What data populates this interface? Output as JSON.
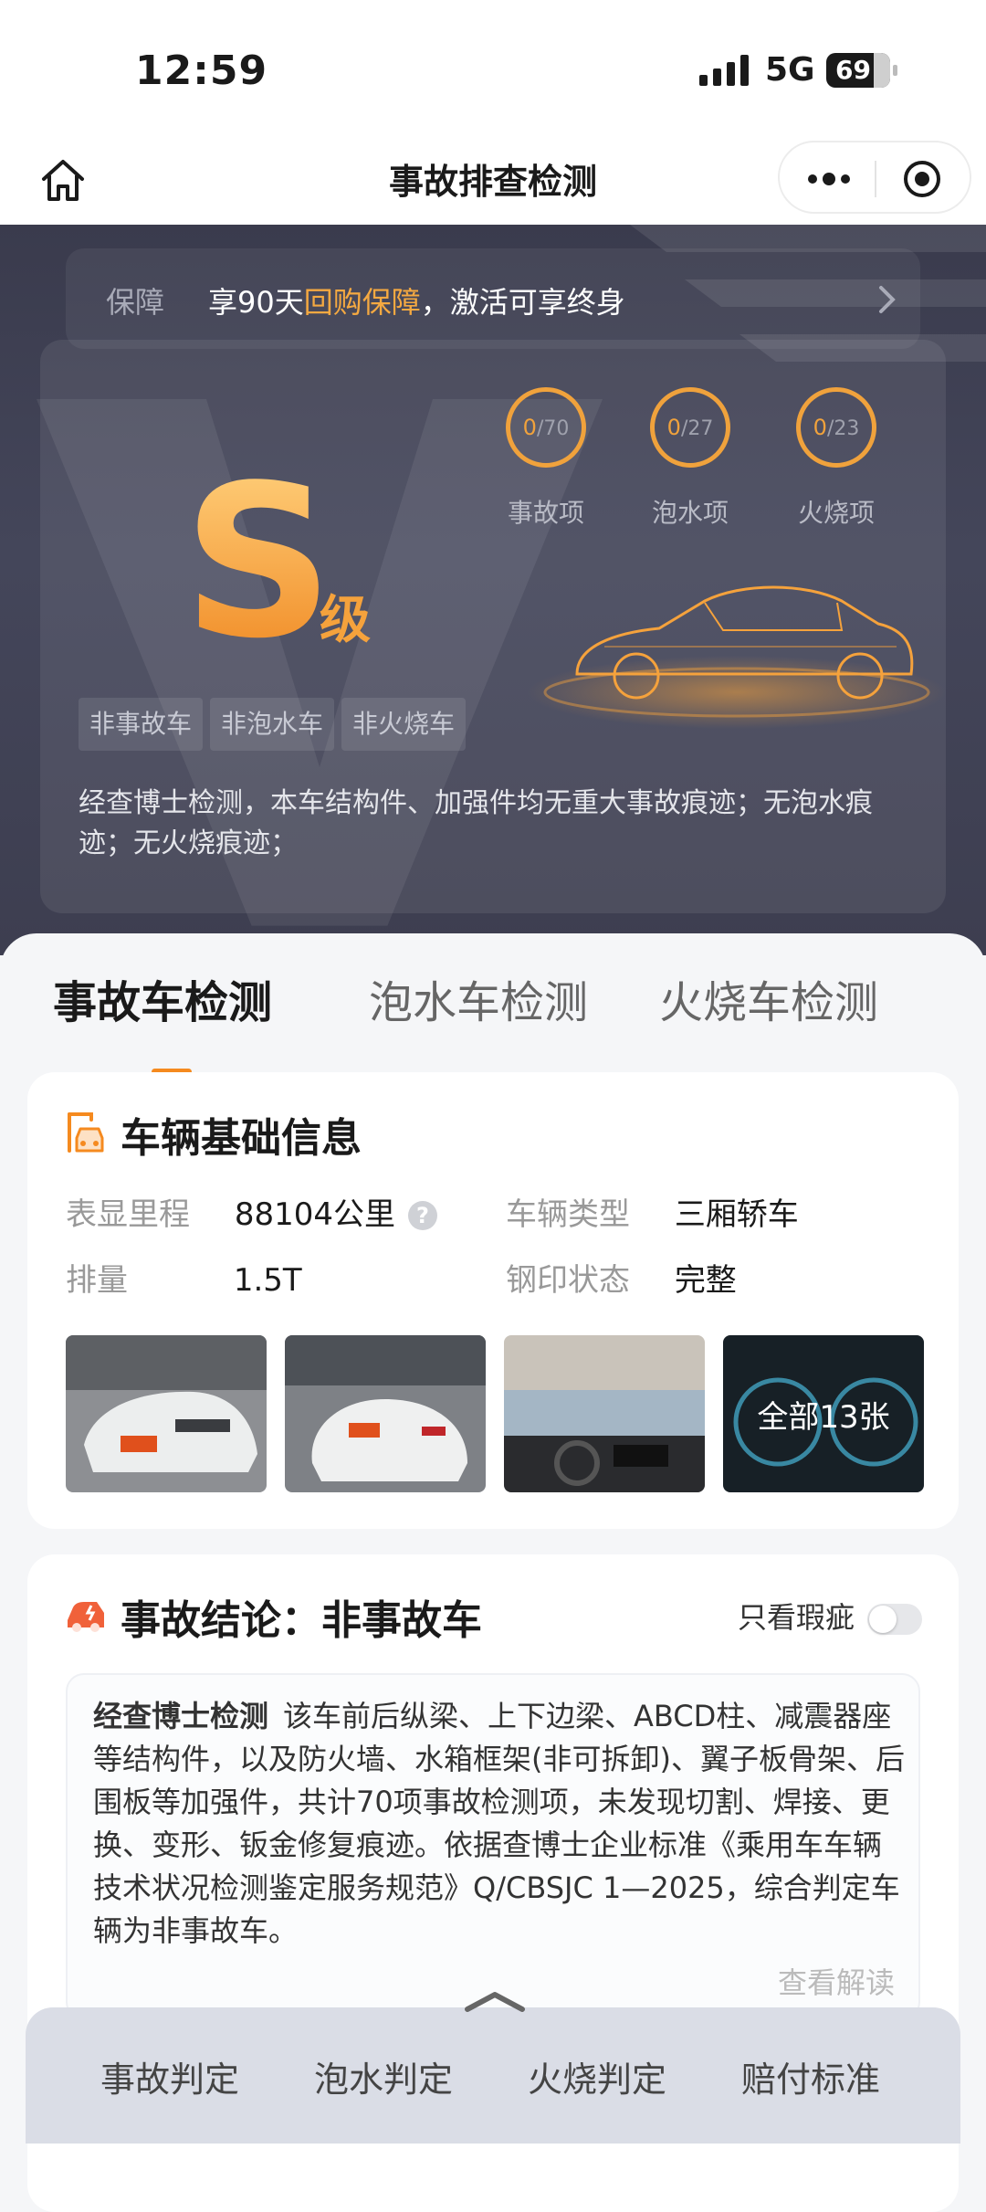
{
  "status_bar": {
    "time": "12:59",
    "network": "5G",
    "battery": "69"
  },
  "nav": {
    "title": "事故排查检测"
  },
  "guarantee": {
    "label": "保障",
    "text_before": "享90天",
    "highlight": "回购保障",
    "text_after": "，激活可享终身"
  },
  "grade": {
    "letter": "S",
    "unit": "级"
  },
  "counters": [
    {
      "count": "0",
      "total": "/70",
      "label": "事故项"
    },
    {
      "count": "0",
      "total": "/27",
      "label": "泡水项"
    },
    {
      "count": "0",
      "total": "/23",
      "label": "火烧项"
    }
  ],
  "tags": [
    "非事故车",
    "非泡水车",
    "非火烧车"
  ],
  "summary": "经查博士检测，本车结构件、加强件均无重大事故痕迹；无泡水痕迹；无火烧痕迹；",
  "tabs": [
    "事故车检测",
    "泡水车检测",
    "火烧车检测"
  ],
  "basic_info": {
    "title": "车辆基础信息",
    "mileage_label": "表显里程",
    "mileage_value": "88104公里",
    "type_label": "车辆类型",
    "type_value": "三厢轿车",
    "displacement_label": "排量",
    "displacement_value": "1.5T",
    "stamp_label": "钢印状态",
    "stamp_value": "完整",
    "photos_more": "全部13张"
  },
  "conclusion": {
    "title": "事故结论：非事故车",
    "toggle_label": "只看瑕疵",
    "brand": "经查博士检测",
    "body": "该车前后纵梁、上下边梁、ABCD柱、减震器座等结构件，以及防火墙、水箱框架(非可拆卸)、翼子板骨架、后围板等加强件，共计70项事故检测项，未发现切割、焊接、更换、变形、钣金修复痕迹。依据查博士企业标准《乘用车车辆技术状况检测鉴定服务规范》Q/CBSJC 1—2025，综合判定车辆为非事故车。",
    "read_more": "查看解读"
  },
  "bottom_tabs": [
    "事故判定",
    "泡水判定",
    "火烧判定",
    "赔付标准"
  ],
  "colors": {
    "accent": "#f58a1f",
    "hero_bg": "#3f4054",
    "gold": "#f5a23c"
  }
}
